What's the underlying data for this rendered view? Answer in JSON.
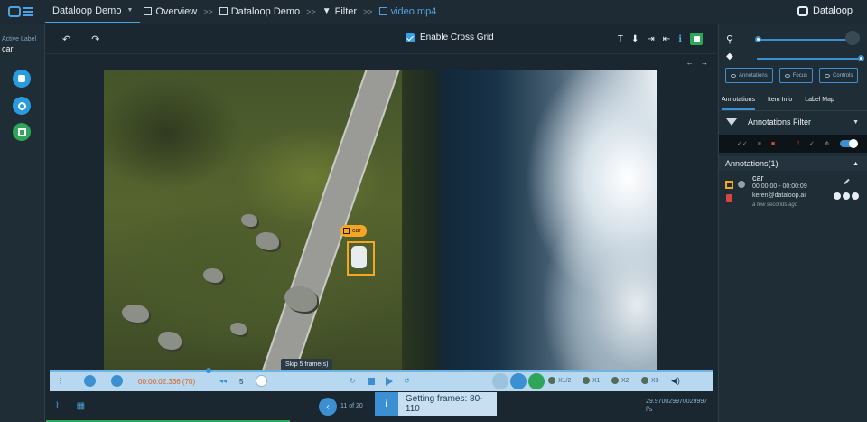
{
  "topbar": {
    "project": "Dataloop Demo",
    "crumbs": [
      "Overview",
      "Dataloop Demo",
      "Filter",
      "video.mp4"
    ],
    "brand": "Dataloop"
  },
  "left": {
    "active_label_title": "Active Label",
    "active_label_value": "car"
  },
  "toolbar": {
    "undo": "↶ ↷",
    "cross_grid": "Enable Cross Grid",
    "nav_arrows": "← →"
  },
  "video": {
    "bbox_label": "car"
  },
  "controls": {
    "time": "00:00:02.336 (70)",
    "skip_value": "5",
    "skip_tooltip": "Skip 5 frame(s)",
    "speeds": [
      "X1/2",
      "X1",
      "X2",
      "X3"
    ]
  },
  "bottom": {
    "pager": "11 of 20",
    "toast": "Getting frames: 80-110",
    "fps": "29.970029970029997",
    "fps_unit": "f/s"
  },
  "right": {
    "pills": [
      "Annotations",
      "Focus",
      "Controls"
    ],
    "tabs": [
      "Annotations",
      "Item Info",
      "Label Map"
    ],
    "filter_title": "Annotations Filter",
    "annotations_header": "Annotations(1)",
    "annotation": {
      "label": "car",
      "time": "00:00:00 - 00:00:09",
      "email": "keren@dataloop.ai",
      "ago": "a few seconds ago"
    }
  },
  "colors": {
    "accent": "#3c8fd0",
    "bbox": "#f5a623",
    "save": "#2fa55a"
  },
  "progress": {
    "scrub_fraction": 0.24
  }
}
